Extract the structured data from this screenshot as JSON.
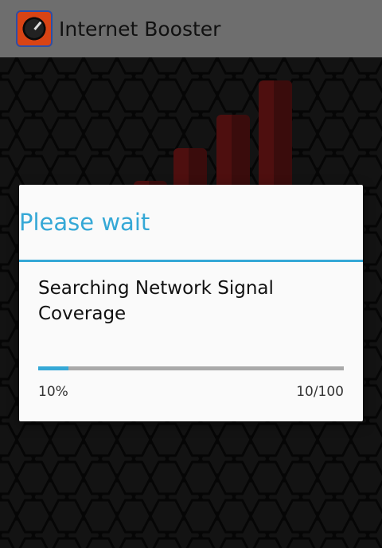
{
  "app_bar": {
    "title": "Internet Booster",
    "icon": "speedometer-icon",
    "background": "#6e6e6e"
  },
  "background": {
    "pattern": "hexagon",
    "bar_color": "#8e1d1d"
  },
  "dialog": {
    "title": "Please wait",
    "message": "Searching Network Signal Coverage",
    "accent": "#35a8d6",
    "progress": {
      "fraction": 0.1,
      "percent_label": "10%",
      "count_label": "10/100"
    }
  }
}
